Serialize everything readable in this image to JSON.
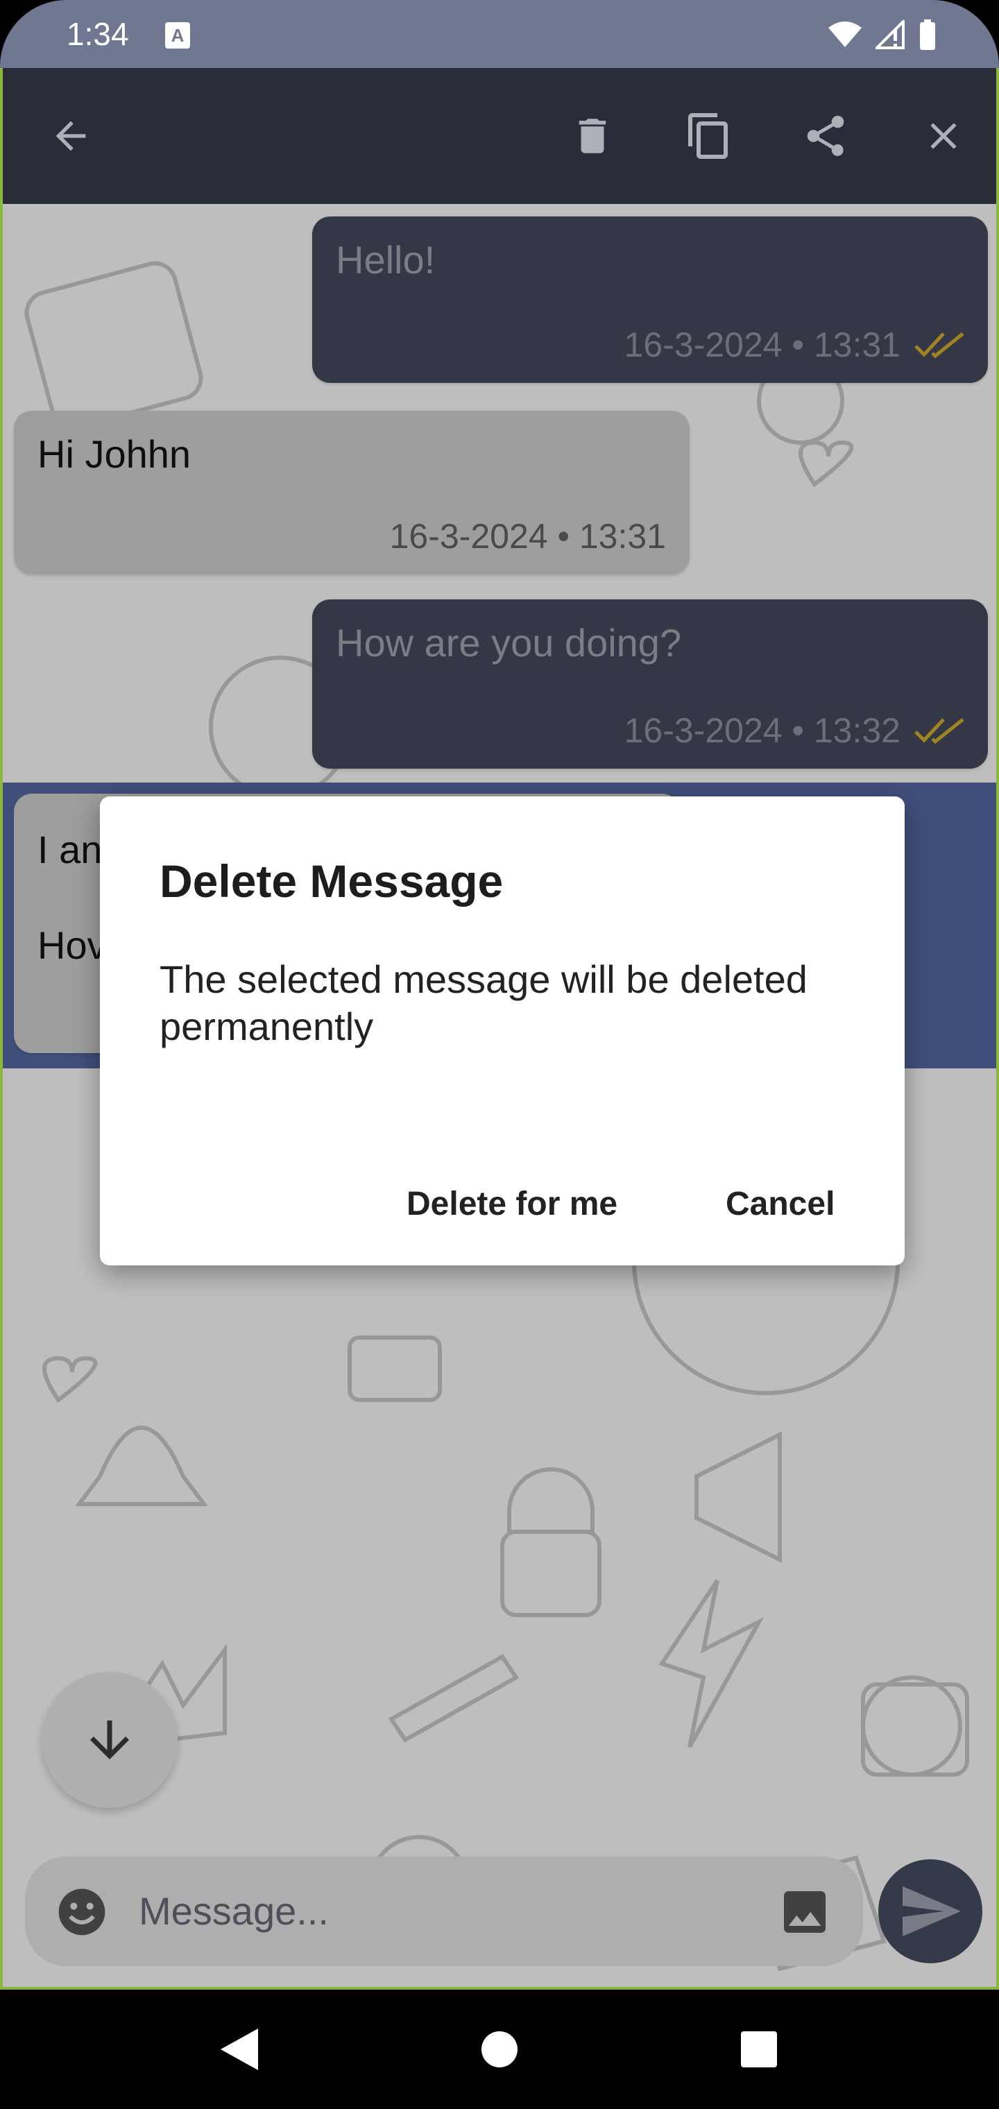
{
  "status_bar": {
    "time": "1:34",
    "notification_icon": "a-icon"
  },
  "toolbar": {
    "back_icon": "arrow-left-icon",
    "actions": [
      "delete-icon",
      "copy-icon",
      "share-icon",
      "close-icon"
    ]
  },
  "messages": [
    {
      "direction": "outgoing",
      "text": "Hello!",
      "timestamp": "16-3-2024 • 13:31",
      "status_icon": "double-check-icon"
    },
    {
      "direction": "incoming",
      "text": "Hi Johhn",
      "timestamp": "16-3-2024 • 13:31"
    },
    {
      "direction": "outgoing",
      "text": "How are you doing?",
      "timestamp": "16-3-2024 • 13:32",
      "status_icon": "double-check-icon"
    },
    {
      "direction": "incoming",
      "text_visible_line1": "I an",
      "text_visible_line2": "Hov",
      "selected": true
    }
  ],
  "dialog": {
    "title": "Delete Message",
    "body": "The selected message will be deleted permanently",
    "buttons": {
      "delete_for_me": "Delete for me",
      "cancel": "Cancel"
    }
  },
  "composer": {
    "placeholder": "Message...",
    "emoji_icon": "emoji-icon",
    "attach_icon": "image-icon",
    "send_icon": "send-icon"
  },
  "scroll_down_icon": "arrow-down-icon",
  "colors": {
    "status_bar": "#707791",
    "toolbar": "#2f3341",
    "outgoing_bubble": "#3c4050",
    "incoming_bubble": "#b4b4b4",
    "selected_highlight": "#4a5a8c",
    "read_tick": "#b8962a",
    "dialog_bg": "#ffffff"
  }
}
